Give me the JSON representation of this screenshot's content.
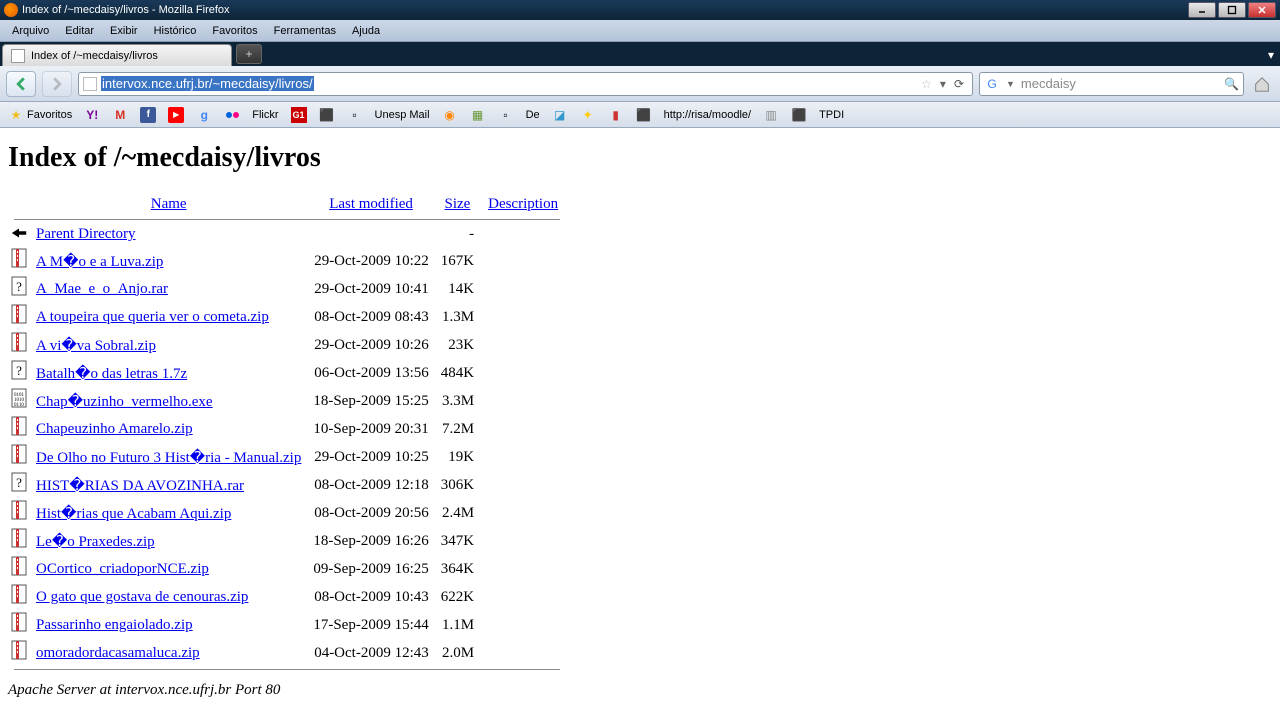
{
  "window": {
    "title": "Index of /~mecdaisy/livros - Mozilla Firefox"
  },
  "menu": [
    "Arquivo",
    "Editar",
    "Exibir",
    "Histórico",
    "Favoritos",
    "Ferramentas",
    "Ajuda"
  ],
  "tab": {
    "label": "Index of /~mecdaisy/livros"
  },
  "url": "intervox.nce.ufrj.br/~mecdaisy/livros/",
  "search": {
    "value": "mecdaisy"
  },
  "bookmarks": {
    "favoritos": "Favoritos",
    "flickr": "Flickr",
    "unesp": "Unesp Mail",
    "de": "De",
    "risa": "http://risa/moodle/",
    "tpdi": "TPDI"
  },
  "page": {
    "heading": "Index of /~mecdaisy/livros",
    "columns": {
      "name": "Name",
      "modified": "Last modified",
      "size": "Size",
      "desc": "Description"
    },
    "parent": "Parent Directory",
    "parent_size": "-",
    "rows": [
      {
        "icon": "zip",
        "name": "A M�o e a Luva.zip",
        "modified": "29-Oct-2009 10:22",
        "size": "167K"
      },
      {
        "icon": "unk",
        "name": "A_Mae_e_o_Anjo.rar",
        "modified": "29-Oct-2009 10:41",
        "size": "14K"
      },
      {
        "icon": "zip",
        "name": "A toupeira que queria ver o cometa.zip",
        "modified": "08-Oct-2009 08:43",
        "size": "1.3M"
      },
      {
        "icon": "zip",
        "name": "A vi�va Sobral.zip",
        "modified": "29-Oct-2009 10:26",
        "size": "23K"
      },
      {
        "icon": "unk",
        "name": "Batalh�o das letras 1.7z",
        "modified": "06-Oct-2009 13:56",
        "size": "484K"
      },
      {
        "icon": "exe",
        "name": "Chap�uzinho_vermelho.exe",
        "modified": "18-Sep-2009 15:25",
        "size": "3.3M"
      },
      {
        "icon": "zip",
        "name": "Chapeuzinho Amarelo.zip",
        "modified": "10-Sep-2009 20:31",
        "size": "7.2M"
      },
      {
        "icon": "zip",
        "name": "De Olho no Futuro 3 Hist�ria - Manual.zip",
        "modified": "29-Oct-2009 10:25",
        "size": "19K"
      },
      {
        "icon": "unk",
        "name": "HIST�RIAS DA AVOZINHA.rar",
        "modified": "08-Oct-2009 12:18",
        "size": "306K"
      },
      {
        "icon": "zip",
        "name": "Hist�rias que Acabam Aqui.zip",
        "modified": "08-Oct-2009 20:56",
        "size": "2.4M"
      },
      {
        "icon": "zip",
        "name": "Le�o Praxedes.zip",
        "modified": "18-Sep-2009 16:26",
        "size": "347K"
      },
      {
        "icon": "zip",
        "name": "OCortico_criadoporNCE.zip",
        "modified": "09-Sep-2009 16:25",
        "size": "364K"
      },
      {
        "icon": "zip",
        "name": "O gato que gostava de cenouras.zip",
        "modified": "08-Oct-2009 10:43",
        "size": "622K"
      },
      {
        "icon": "zip",
        "name": "Passarinho engaiolado.zip",
        "modified": "17-Sep-2009 15:44",
        "size": "1.1M"
      },
      {
        "icon": "zip",
        "name": "omoradordacasamaluca.zip",
        "modified": "04-Oct-2009 12:43",
        "size": "2.0M"
      }
    ],
    "footer": "Apache Server at intervox.nce.ufrj.br Port 80"
  }
}
